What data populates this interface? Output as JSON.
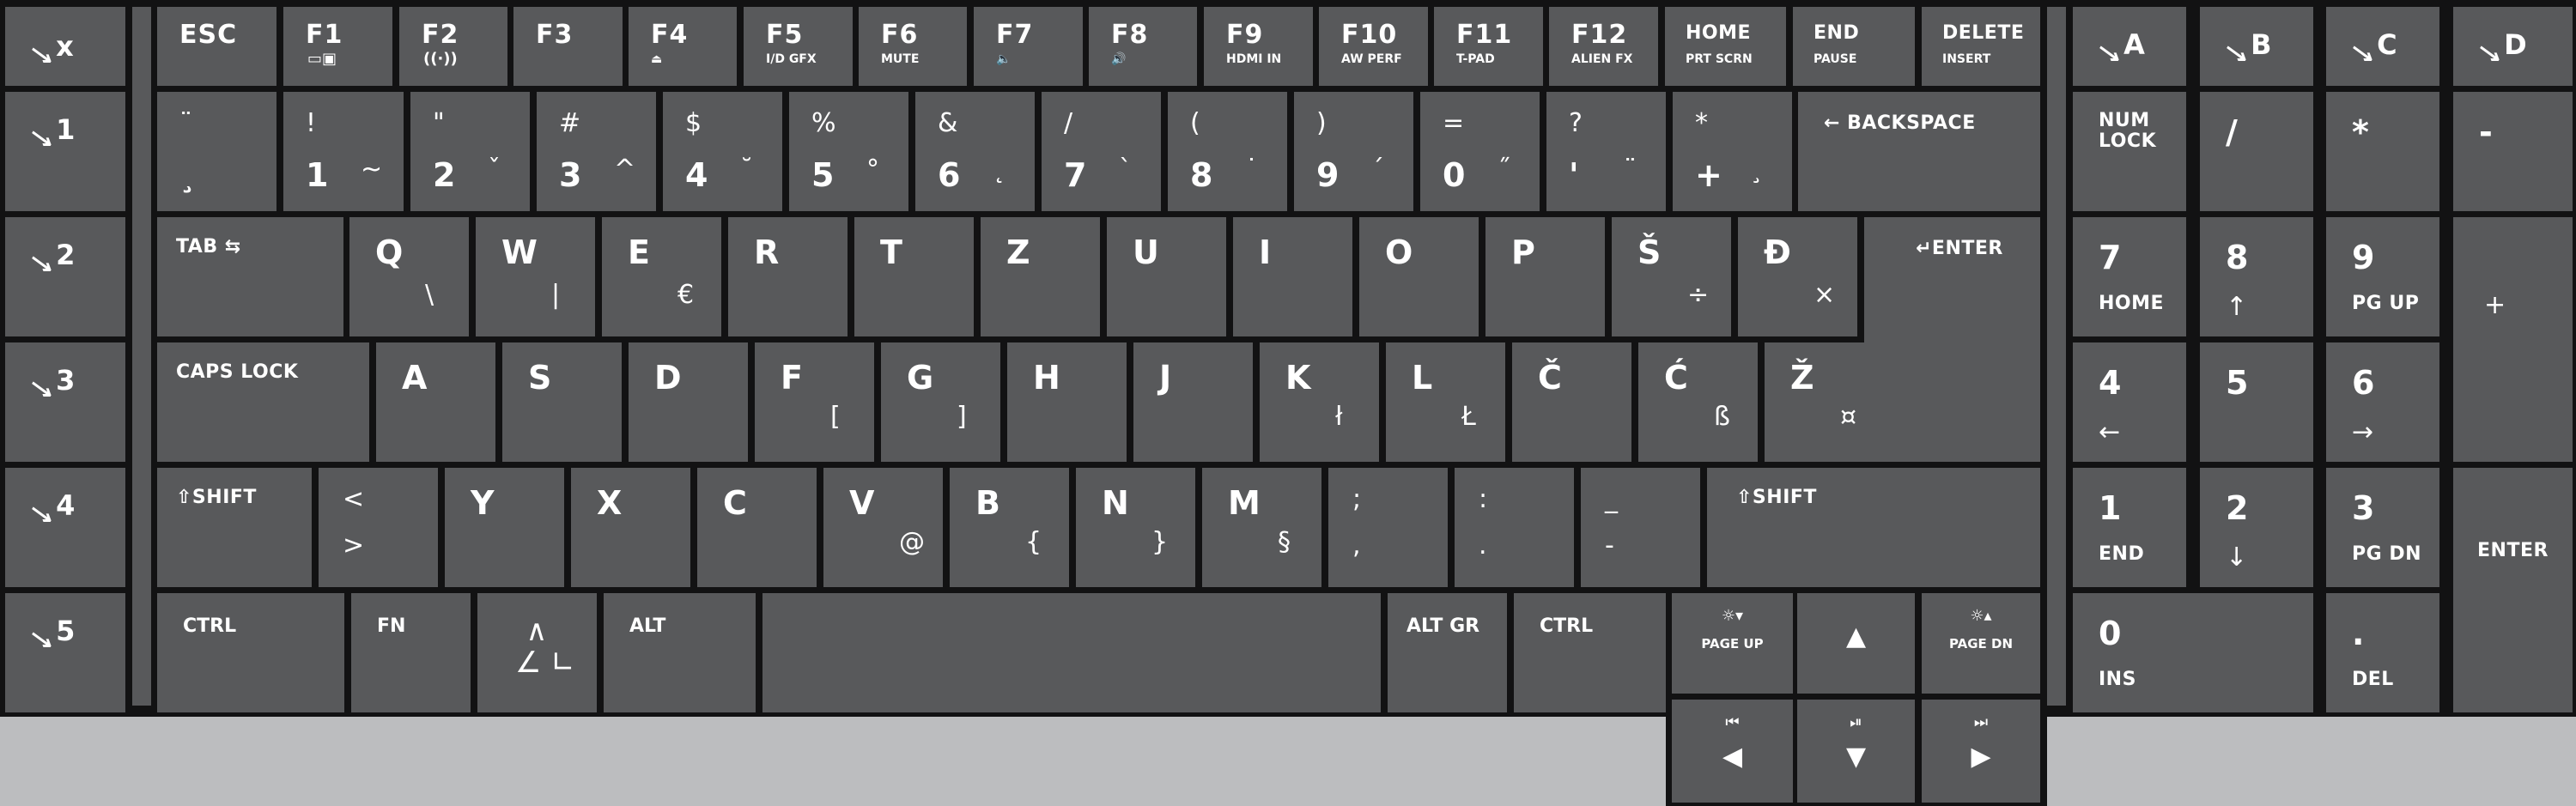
{
  "keyboard": {
    "colors": {
      "key": "#58595b",
      "frame": "#121213",
      "background": "#bcbdbf",
      "legend": "#ffffff"
    },
    "macro_keys": [
      {
        "icon": "macro-icon",
        "label": "x"
      },
      {
        "icon": "macro-icon",
        "label": "1"
      },
      {
        "icon": "macro-icon",
        "label": "2"
      },
      {
        "icon": "macro-icon",
        "label": "3"
      },
      {
        "icon": "macro-icon",
        "label": "4"
      },
      {
        "icon": "macro-icon",
        "label": "5"
      }
    ],
    "macro_numpad": [
      {
        "icon": "macro-icon",
        "label": "A"
      },
      {
        "icon": "macro-icon",
        "label": "B"
      },
      {
        "icon": "macro-icon",
        "label": "C"
      },
      {
        "icon": "macro-icon",
        "label": "D"
      }
    ],
    "function_row": [
      {
        "main": "ESC",
        "sub": ""
      },
      {
        "main": "F1",
        "sub": "",
        "icon": "display-switch-icon"
      },
      {
        "main": "F2",
        "sub": "",
        "icon": "wireless-icon"
      },
      {
        "main": "F3",
        "sub": ""
      },
      {
        "main": "F4",
        "sub": "⏏",
        "icon": "eject-icon"
      },
      {
        "main": "F5",
        "sub": "I/D GFX"
      },
      {
        "main": "F6",
        "sub": "MUTE"
      },
      {
        "main": "F7",
        "sub": "🔈",
        "icon": "volume-down-icon"
      },
      {
        "main": "F8",
        "sub": "🔊",
        "icon": "volume-up-icon"
      },
      {
        "main": "F9",
        "sub": "HDMI IN"
      },
      {
        "main": "F10",
        "sub": "AW PERF"
      },
      {
        "main": "F11",
        "sub": "T-PAD"
      },
      {
        "main": "F12",
        "sub": "ALIEN FX"
      },
      {
        "main": "HOME",
        "sub": "PRT SCRN"
      },
      {
        "main": "END",
        "sub": "PAUSE"
      },
      {
        "main": "DELETE",
        "sub": "INSERT"
      }
    ],
    "number_row": [
      {
        "top": "¨",
        "bottom": "¸",
        "alt": ""
      },
      {
        "top": "!",
        "bottom": "1",
        "alt": "~"
      },
      {
        "top": "\"",
        "bottom": "2",
        "alt": "ˇ"
      },
      {
        "top": "#",
        "bottom": "3",
        "alt": "^"
      },
      {
        "top": "$",
        "bottom": "4",
        "alt": "˘"
      },
      {
        "top": "%",
        "bottom": "5",
        "alt": "°"
      },
      {
        "top": "&",
        "bottom": "6",
        "alt": "˛"
      },
      {
        "top": "/",
        "bottom": "7",
        "alt": "`"
      },
      {
        "top": "(",
        "bottom": "8",
        "alt": "˙"
      },
      {
        "top": ")",
        "bottom": "9",
        "alt": "´"
      },
      {
        "top": "=",
        "bottom": "0",
        "alt": "˝"
      },
      {
        "top": "?",
        "bottom": "'",
        "alt": "¨"
      },
      {
        "top": "*",
        "bottom": "+",
        "alt": "¸"
      },
      {
        "label": "← BACKSPACE"
      }
    ],
    "qwerty_row": [
      {
        "label": "TAB ⇆"
      },
      {
        "main": "Q",
        "alt": "\\"
      },
      {
        "main": "W",
        "alt": "|"
      },
      {
        "main": "E",
        "alt": "€"
      },
      {
        "main": "R",
        "alt": ""
      },
      {
        "main": "T",
        "alt": ""
      },
      {
        "main": "Z",
        "alt": ""
      },
      {
        "main": "U",
        "alt": ""
      },
      {
        "main": "I",
        "alt": ""
      },
      {
        "main": "O",
        "alt": ""
      },
      {
        "main": "P",
        "alt": ""
      },
      {
        "main": "Š",
        "alt": "÷"
      },
      {
        "main": "Đ",
        "alt": "×"
      },
      {
        "label": "↵ENTER"
      }
    ],
    "home_row": [
      {
        "label": "CAPS LOCK"
      },
      {
        "main": "A",
        "alt": ""
      },
      {
        "main": "S",
        "alt": ""
      },
      {
        "main": "D",
        "alt": ""
      },
      {
        "main": "F",
        "alt": "["
      },
      {
        "main": "G",
        "alt": "]"
      },
      {
        "main": "H",
        "alt": ""
      },
      {
        "main": "J",
        "alt": ""
      },
      {
        "main": "K",
        "alt": "ł"
      },
      {
        "main": "L",
        "alt": "Ł"
      },
      {
        "main": "Č",
        "alt": ""
      },
      {
        "main": "Ć",
        "alt": "ß"
      },
      {
        "main": "Ž",
        "alt": "¤"
      }
    ],
    "shift_row": [
      {
        "label": "⇧SHIFT"
      },
      {
        "top": "<",
        "bottom": ">"
      },
      {
        "main": "Y",
        "alt": ""
      },
      {
        "main": "X",
        "alt": ""
      },
      {
        "main": "C",
        "alt": ""
      },
      {
        "main": "V",
        "alt": "@"
      },
      {
        "main": "B",
        "alt": "{"
      },
      {
        "main": "N",
        "alt": "}"
      },
      {
        "main": "M",
        "alt": "§"
      },
      {
        "top": ";",
        "bottom": ","
      },
      {
        "top": ":",
        "bottom": "."
      },
      {
        "top": "_",
        "bottom": "-"
      },
      {
        "label": "⇧SHIFT"
      }
    ],
    "bottom_row": [
      {
        "label": "CTRL"
      },
      {
        "label": "FN"
      },
      {
        "label": "alienware-logo",
        "icon": "alienware-logo-icon"
      },
      {
        "label": "ALT"
      },
      {
        "label": ""
      },
      {
        "label": "ALT GR"
      },
      {
        "label": "CTRL"
      }
    ],
    "arrow_cluster": [
      {
        "icon_text": "☼▾",
        "label": "PAGE UP",
        "icon": "brightness-down-icon"
      },
      {
        "icon_text": "▲",
        "label": "",
        "icon": "arrow-up-icon"
      },
      {
        "icon_text": "☼▴",
        "label": "PAGE DN",
        "icon": "brightness-up-icon"
      },
      {
        "icon_text": "⏮",
        "label": "◀",
        "icon": "arrow-left-icon"
      },
      {
        "icon_text": "⏯",
        "label": "▼",
        "icon": "arrow-down-icon"
      },
      {
        "icon_text": "⏭",
        "label": "▶",
        "icon": "arrow-right-icon"
      }
    ],
    "numpad": [
      {
        "main": "NUM\nLOCK",
        "sub": ""
      },
      {
        "main": "/",
        "sub": ""
      },
      {
        "main": "*",
        "sub": ""
      },
      {
        "main": "-",
        "sub": ""
      },
      {
        "main": "7",
        "sub": "HOME"
      },
      {
        "main": "8",
        "sub": "↑"
      },
      {
        "main": "9",
        "sub": "PG UP"
      },
      {
        "main": "+",
        "sub": ""
      },
      {
        "main": "4",
        "sub": "←"
      },
      {
        "main": "5",
        "sub": ""
      },
      {
        "main": "6",
        "sub": "→"
      },
      {
        "main": "1",
        "sub": "END"
      },
      {
        "main": "2",
        "sub": "↓"
      },
      {
        "main": "3",
        "sub": "PG DN"
      },
      {
        "main": "ENTER",
        "sub": ""
      },
      {
        "main": "0",
        "sub": "INS"
      },
      {
        "main": ".",
        "sub": "DEL"
      }
    ]
  }
}
